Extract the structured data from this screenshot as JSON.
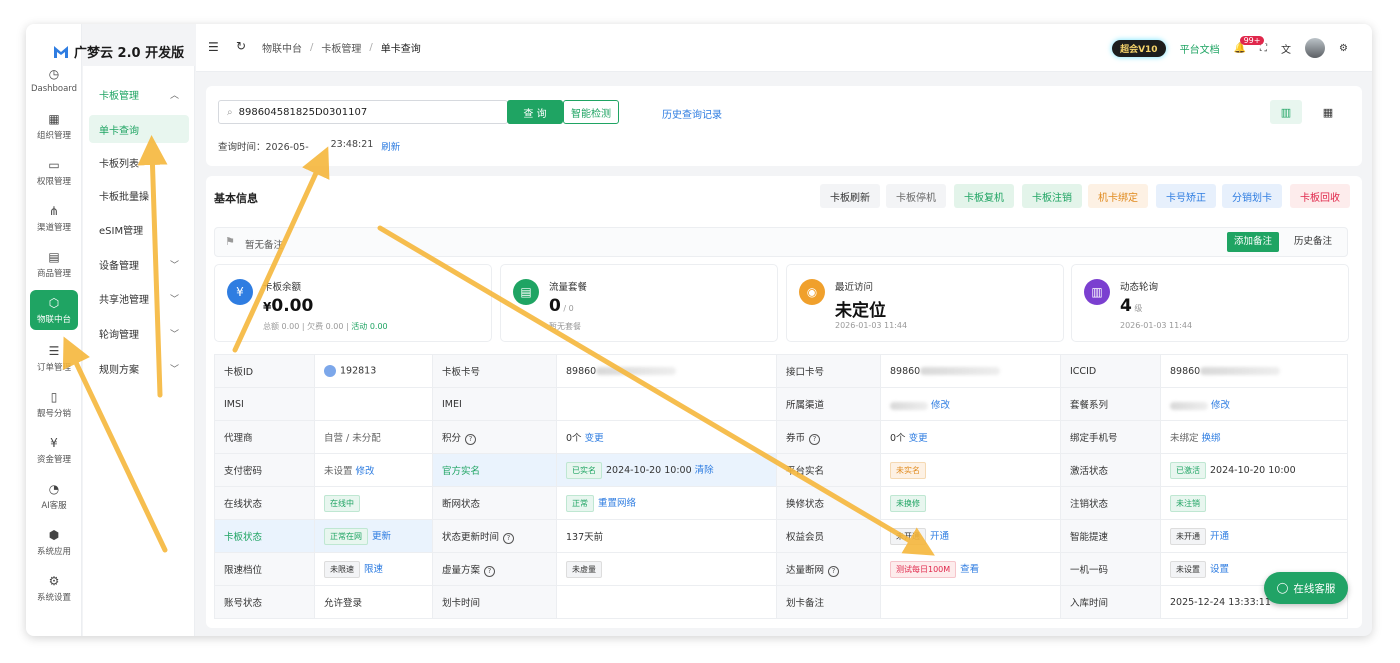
{
  "app": {
    "title": "广梦云 2.0 开发版"
  },
  "rail": [
    {
      "label": "Dashboard",
      "icon": "dashboard-icon",
      "glyph": "◷"
    },
    {
      "label": "组织管理",
      "icon": "grid-icon",
      "glyph": "▦"
    },
    {
      "label": "权限管理",
      "icon": "monitor-icon",
      "glyph": "▭"
    },
    {
      "label": "渠道管理",
      "icon": "network-icon",
      "glyph": "⋔"
    },
    {
      "label": "商品管理",
      "icon": "store-icon",
      "glyph": "▤"
    },
    {
      "label": "物联中台",
      "icon": "iot-icon",
      "glyph": "⬡"
    },
    {
      "label": "订单管理",
      "icon": "list-icon",
      "glyph": "☰"
    },
    {
      "label": "靓号分销",
      "icon": "phone-icon",
      "glyph": "▯"
    },
    {
      "label": "资金管理",
      "icon": "wallet-icon",
      "glyph": "¥"
    },
    {
      "label": "AI客服",
      "icon": "ai-icon",
      "glyph": "◔"
    },
    {
      "label": "系统应用",
      "icon": "cube-icon",
      "glyph": "⬢"
    },
    {
      "label": "系统设置",
      "icon": "gear-icon",
      "glyph": "⚙"
    }
  ],
  "sub": [
    {
      "label": "卡板管理",
      "chev": "︿"
    },
    {
      "label": "单卡查询",
      "chev": ""
    },
    {
      "label": "卡板列表",
      "chev": ""
    },
    {
      "label": "卡板批量操",
      "chev": ""
    },
    {
      "label": "eSIM管理",
      "chev": ""
    },
    {
      "label": "设备管理",
      "chev": "﹀"
    },
    {
      "label": "共享池管理",
      "chev": "﹀"
    },
    {
      "label": "轮询管理",
      "chev": "﹀"
    },
    {
      "label": "规则方案",
      "chev": "﹀"
    }
  ],
  "breadcrumb": [
    "物联中台",
    "卡板管理",
    "单卡查询"
  ],
  "topbar": {
    "vip": "超会V10",
    "doc": "平台文档",
    "badge": "99+"
  },
  "search": {
    "value": "898604581825D0301107",
    "query_btn": "查 询",
    "smart_btn": "智能检测",
    "history": "历史查询记录",
    "time_label": "查询时间：2026-05-",
    "time_value": "23:48:21",
    "refresh": "刷新"
  },
  "basic": {
    "title": "基本信息",
    "actions": [
      "卡板刷新",
      "卡板停机",
      "卡板复机",
      "卡板注销",
      "机卡绑定",
      "卡号矫正",
      "分销划卡",
      "卡板回收"
    ]
  },
  "note": {
    "text": "暂无备注",
    "add": "添加备注",
    "history": "历史备注"
  },
  "stats": [
    {
      "label": "卡板余额",
      "prefix": "¥",
      "value": "0.00",
      "suffix": "",
      "foot": "总额 0.00 | 欠费 0.00 | ",
      "foot2": "活动 0.00",
      "color": "#2f7de1",
      "glyph": "¥"
    },
    {
      "label": "流量套餐",
      "prefix": "",
      "value": "0",
      "suffix": " / 0",
      "foot": "暂无套餐",
      "foot2": "",
      "color": "#1fa463",
      "glyph": "▤"
    },
    {
      "label": "最近访问",
      "prefix": "",
      "value": "未定位",
      "suffix": "",
      "foot": "2026-01-03 11:44",
      "foot2": "",
      "color": "#f0a02c",
      "glyph": "◉"
    },
    {
      "label": "动态轮询",
      "prefix": "",
      "value": "4",
      "suffix": " 级",
      "foot": "2026-01-03 11:44",
      "foot2": "",
      "color": "#7b3fd0",
      "glyph": "▥"
    }
  ],
  "table": {
    "r1": [
      "卡板ID",
      "192813",
      "卡板卡号",
      "89860",
      "接口卡号",
      "89860",
      "ICCID",
      "89860"
    ],
    "r2": [
      "IMSI",
      "",
      "IMEI",
      "",
      "所属渠道",
      "修改",
      "套餐系列",
      "修改"
    ],
    "r3": [
      "代理商",
      "自营 / 未分配",
      "积分",
      "0个",
      "变更",
      "券币",
      "0个",
      "变更",
      "绑定手机号",
      "未绑定",
      "换绑"
    ],
    "r4": [
      "支付密码",
      "未设置",
      "修改",
      "官方实名",
      "已实名",
      "2024-10-20 10:00",
      "清除",
      "平台实名",
      "未实名",
      "激活状态",
      "已激活",
      "2024-10-20 10:00"
    ],
    "r5": [
      "在线状态",
      "在线中",
      "断网状态",
      "正常",
      "重置网络",
      "换修状态",
      "未换修",
      "注销状态",
      "未注销"
    ],
    "r6": [
      "卡板状态",
      "正常在网",
      "更新",
      "状态更新时间",
      "137天前",
      "权益会员",
      "未开通",
      "开通",
      "智能提速",
      "未开通",
      "开通"
    ],
    "r7": [
      "限速档位",
      "未限速",
      "限速",
      "虚量方案",
      "未虚量",
      "达量断网",
      "测试每日100M",
      "查看",
      "一机一码",
      "未设置",
      "设置"
    ],
    "r8": [
      "账号状态",
      "允许登录",
      "划卡时间",
      "",
      "划卡备注",
      "",
      "入库时间",
      "2025-12-24 13:33:11"
    ]
  },
  "chat": {
    "label": "在线客服"
  }
}
